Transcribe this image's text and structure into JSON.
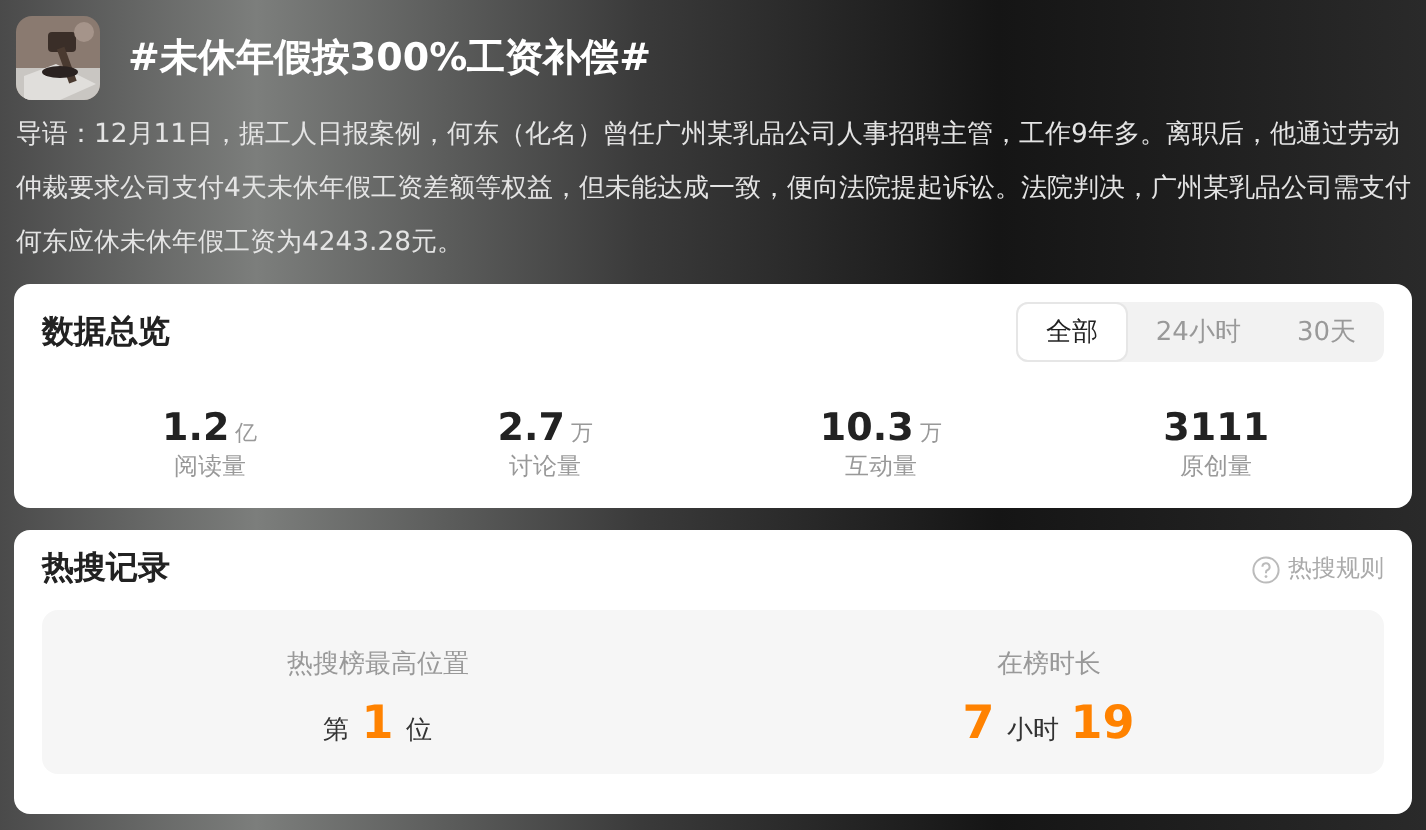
{
  "header": {
    "title": "#未休年假按300%工资补偿#",
    "intro": "导语：12月11日，据工人日报案例，何东（化名）曾任广州某乳品公司人事招聘主管，工作9年多。离职后，他通过劳动仲裁要求公司支付4天未休年假工资差额等权益，但未能达成一致，便向法院提起诉讼。法院判决，广州某乳品公司需支付何东应休未休年假工资为4243.28元。"
  },
  "overview": {
    "title": "数据总览",
    "tabs": [
      {
        "label": "全部",
        "selected": true
      },
      {
        "label": "24小时",
        "selected": false
      },
      {
        "label": "30天",
        "selected": false
      }
    ],
    "stats": [
      {
        "value": "1.2",
        "unit": "亿",
        "label": "阅读量"
      },
      {
        "value": "2.7",
        "unit": "万",
        "label": "讨论量"
      },
      {
        "value": "10.3",
        "unit": "万",
        "label": "互动量"
      },
      {
        "value": "3111",
        "label": "原创量"
      }
    ]
  },
  "hot_record": {
    "title": "热搜记录",
    "rules_link": "热搜规则",
    "items": [
      {
        "label": "热搜榜最高位置",
        "parts": [
          {
            "kind": "unit",
            "text": "第"
          },
          {
            "kind": "number",
            "text": "1"
          },
          {
            "kind": "unit",
            "text": "位"
          }
        ]
      },
      {
        "label": "在榜时长",
        "parts": [
          {
            "kind": "number",
            "text": "7"
          },
          {
            "kind": "unit",
            "text": "小时"
          },
          {
            "kind": "number",
            "text": "19"
          }
        ]
      }
    ]
  }
}
